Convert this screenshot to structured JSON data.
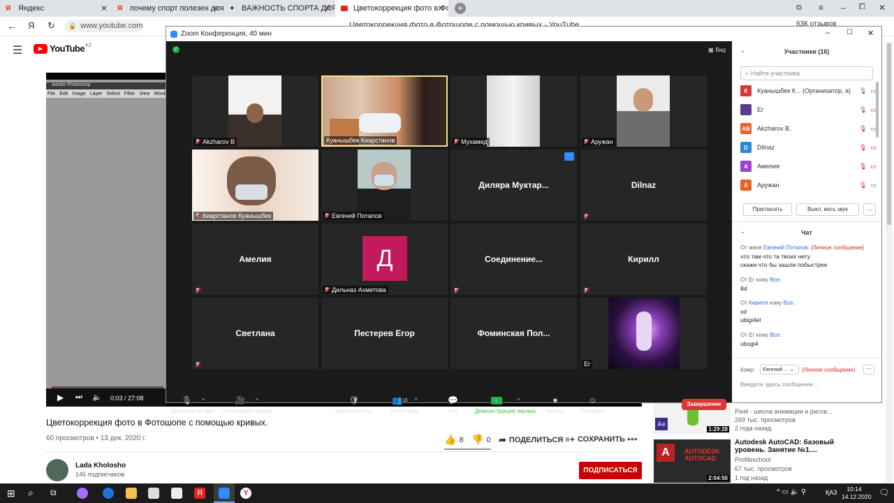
{
  "browser": {
    "tabs": [
      {
        "label": "Яндекс",
        "fav": "yandex-icon"
      },
      {
        "label": "почему спорт полезен для",
        "fav": "yandex-icon"
      },
      {
        "label": "ВАЖНОСТЬ СПОРТА ДЛЯ Д",
        "fav": "spark-icon"
      },
      {
        "label": "Цветокоррекция фото в Фо",
        "fav": "youtube-icon"
      }
    ],
    "address": "www.youtube.com",
    "page_title": "Цветокоррекция фото в Фотошопе с помощью кривых - YouTube",
    "reviews": "63К отзывов"
  },
  "youtube": {
    "logo": "YouTube",
    "region": "KZ",
    "player": {
      "time": "0:03 / 27:08",
      "progress": 0.002,
      "ps_title": "Adobe Photoshop",
      "ps_menu": [
        "File",
        "Edit",
        "Image",
        "Layer",
        "Select",
        "Filter",
        "View",
        "Window"
      ]
    },
    "video_title": "Цветокоррекция фото в Фотошопе с помощью кривых.",
    "meta": "60 просмотров • 13 дек. 2020 г.",
    "likes": "8",
    "dislikes": "0",
    "share": "ПОДЕЛИТЬСЯ",
    "save": "СОХРАНИТЬ",
    "channel": {
      "name": "Lada Kholosho",
      "subs": "146 подписчиков"
    },
    "subscribe": "ПОДПИСАТЬСЯ",
    "related": [
      {
        "title": "",
        "channel": "Pixel - школа анимации и рисов...",
        "views": "269 тыс. просмотров",
        "age": "2 года назад",
        "duration": "1:29:28"
      },
      {
        "title": "Autodesk AutoCAD: базовый уровень. Занятие №1....",
        "channel": "Profileschool",
        "views": "67 тыс. просмотров",
        "age": "1 год назад",
        "duration": "2:04:50"
      }
    ]
  },
  "zoom": {
    "title": "Zoom Конференция, 40 мин",
    "view": "Вид",
    "tiles": [
      {
        "label": "Akzharov B"
      },
      {
        "label": "Куанышбек Киарстанов"
      },
      {
        "label": "Мухамед"
      },
      {
        "label": "Аружан"
      },
      {
        "label": "Киарстанов Куанышбек"
      },
      {
        "label": "Евгений Потапов"
      },
      {
        "name": "Диляра  Муктар..."
      },
      {
        "name": "Dilnaz"
      },
      {
        "name": "Амелия"
      },
      {
        "label": "Дильназ Ахметова",
        "avatar": "Д"
      },
      {
        "name": "Соединение..."
      },
      {
        "name": "Кирилл"
      },
      {
        "name": "Светлана"
      },
      {
        "name": "Пестерев Егор"
      },
      {
        "name": "Фоминская  Пол..."
      },
      {
        "label": "Ег"
      }
    ],
    "controls": [
      "Выключить звук",
      "Остановить видео",
      "Безопасность",
      "Участники",
      "Чат",
      "Демонстрация экрана",
      "Запись",
      "Реакции"
    ],
    "participants_count": "16",
    "end": "Завершение",
    "participants_header": "Участники (16)",
    "search_placeholder": "Найти участника",
    "participants": [
      {
        "initial": "К",
        "name": "Куанышбек К... (Организатор, я)",
        "color": "#d9363e"
      },
      {
        "initial": "",
        "name": "Ег",
        "color": "#5b3d8a"
      },
      {
        "initial": "AB",
        "name": "Akzharov B.",
        "color": "#e8622b"
      },
      {
        "initial": "D",
        "name": "Dilnaz",
        "color": "#2b88d9"
      },
      {
        "initial": "А",
        "name": "Амелия",
        "color": "#9b44c9"
      },
      {
        "initial": "А",
        "name": "Аружан",
        "color": "#e8622b"
      }
    ],
    "invite": "Пригласить",
    "mute_all": "Выкл. весь звук",
    "more": "...",
    "chat_header": "Чат",
    "chat": [
      {
        "from_prefix": "От меня",
        "from": "Евгений Потапов:",
        "tag": "(Личное сообщение)",
        "lines": [
          "что там что та твоих нету",
          "скажи что бы зашли побыстрее"
        ]
      },
      {
        "from_prefix": "От",
        "from": "Ег",
        "to": "кому",
        "to_name": "Все:",
        "lines": [
          "8d"
        ]
      },
      {
        "from_prefix": "От",
        "from": "Кирилл",
        "to": "кому",
        "to_name": "Все:",
        "lines": [
          "xd",
          "ubigi4el"
        ]
      },
      {
        "from_prefix": "От",
        "from": "Ег",
        "to": "кому",
        "to_name": "Все:",
        "lines": [
          "ubogi4"
        ]
      }
    ],
    "to_label": "Кому:",
    "to_value": "Евгений ...",
    "to_tag": "(Личное сообщение)",
    "input_placeholder": "Введите здесь сообщение..."
  },
  "taskbar": {
    "lang": "ҚАЗ",
    "time": "10:14",
    "date": "14.12.2020"
  }
}
